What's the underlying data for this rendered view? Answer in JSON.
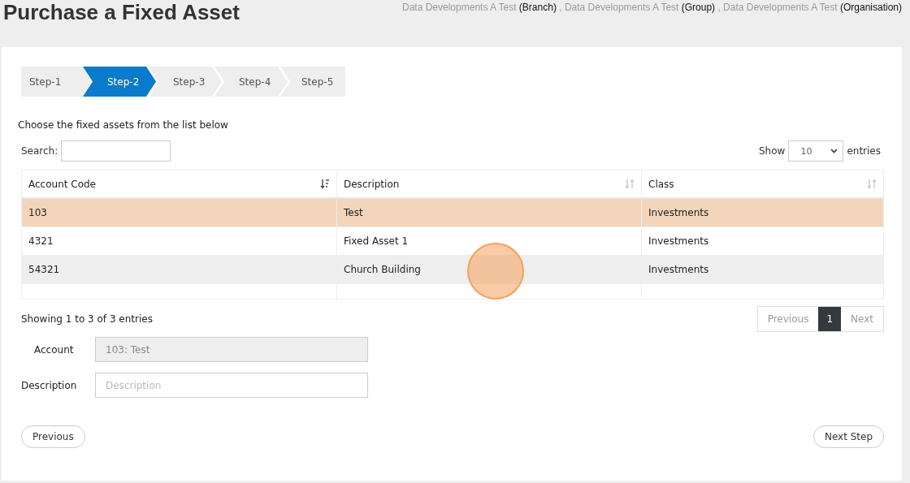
{
  "page_title": "Purchase a Fixed Asset",
  "context": "Data Developments A Test **(Branch)** , Data Developments A Test **(Group)** , Data Developments A Test **(Organisation)**",
  "steps": [
    {
      "label": "Step-1",
      "selected": false
    },
    {
      "label": "Step-2",
      "selected": true
    },
    {
      "label": "Step-3",
      "selected": false
    },
    {
      "label": "Step-4",
      "selected": false
    },
    {
      "label": "Step-5",
      "selected": false
    }
  ],
  "instruction": "Choose the fixed assets from the list below",
  "search": {
    "label": "Search:"
  },
  "length": {
    "show": "Show",
    "value": "10",
    "entries": "entries"
  },
  "table": {
    "columns": [
      {
        "label": "Account Code",
        "sorted": true
      },
      {
        "label": "Description",
        "sorted": false
      },
      {
        "label": "Class",
        "sorted": false
      }
    ],
    "rows": [
      {
        "cells": [
          "103",
          "Test",
          "Investments"
        ],
        "selected": true
      },
      {
        "cells": [
          "4321",
          "Fixed Asset 1",
          "Investments"
        ],
        "selected": false
      },
      {
        "cells": [
          "54321",
          "Church Building",
          "Investments"
        ],
        "selected": false
      }
    ]
  },
  "info": "Showing 1 to 3 of 3 entries",
  "pagination": {
    "previous": "Previous",
    "pages": [
      {
        "label": "1",
        "selected": true
      }
    ],
    "next": "Next"
  },
  "form": {
    "account": {
      "label": "Account",
      "value": "103: Test"
    },
    "description": {
      "label": "Description",
      "placeholder": "Description"
    }
  },
  "buttons": {
    "previous": "Previous",
    "next": "Next Step"
  }
}
